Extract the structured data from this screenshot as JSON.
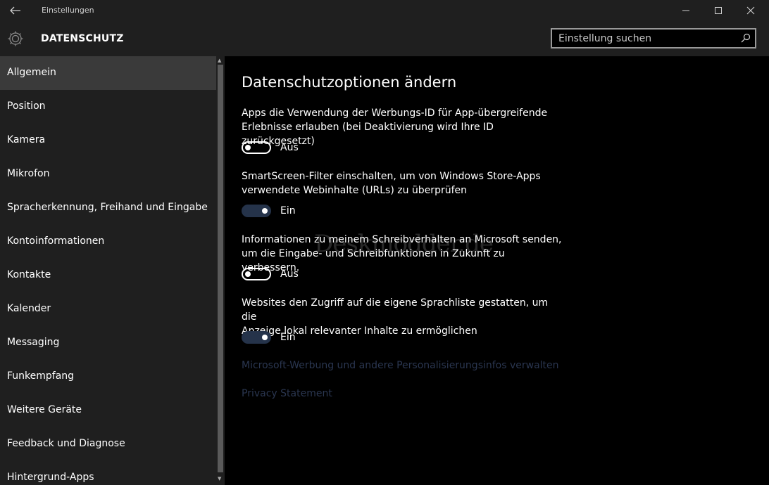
{
  "window": {
    "title": "Einstellungen"
  },
  "header": {
    "section_title": "DATENSCHUTZ",
    "search_placeholder": "Einstellung suchen"
  },
  "sidebar": {
    "items": [
      {
        "label": "Allgemein",
        "active": true
      },
      {
        "label": "Position"
      },
      {
        "label": "Kamera"
      },
      {
        "label": "Mikrofon"
      },
      {
        "label": "Spracherkennung, Freihand und Eingabe"
      },
      {
        "label": "Kontoinformationen"
      },
      {
        "label": "Kontakte"
      },
      {
        "label": "Kalender"
      },
      {
        "label": "Messaging"
      },
      {
        "label": "Funkempfang"
      },
      {
        "label": "Weitere Geräte"
      },
      {
        "label": "Feedback und Diagnose"
      },
      {
        "label": "Hintergrund-Apps"
      }
    ]
  },
  "main": {
    "title": "Datenschutzoptionen ändern",
    "options": [
      {
        "line1": "Apps die Verwendung der Werbungs-ID für App-übergreifende",
        "line2": "Erlebnisse erlauben (bei Deaktivierung wird Ihre ID zurückgesetzt)",
        "state": "Aus"
      },
      {
        "line1": "SmartScreen-Filter einschalten, um von Windows Store-Apps",
        "line2": "verwendete Webinhalte (URLs) zu überprüfen",
        "state": "Ein"
      },
      {
        "line1": "Informationen zu meinem Schreibverhalten an Microsoft senden,",
        "line2": "um die Eingabe- und Schreibfunktionen in Zukunft zu verbessern.",
        "state": "Aus"
      },
      {
        "line1": "Websites den Zugriff auf die eigene Sprachliste gestatten, um die",
        "line2": "Anzeige lokal relevanter Inhalte zu ermöglichen",
        "state": "Ein"
      }
    ],
    "links": [
      "Microsoft-Werbung und andere Personalisierungsinfos verwalten",
      "Privacy Statement"
    ],
    "watermark": "Deskmodder.de"
  },
  "colors": {
    "toggle_on": "#25334a",
    "link": "#2a3650",
    "chrome": "#1f1f1f",
    "active_item": "#3a3a3a"
  },
  "icons": {
    "back": "arrow-left-icon",
    "settings": "gear-icon",
    "search": "search-icon",
    "minimize": "minimize-icon",
    "maximize": "maximize-icon",
    "close": "close-icon"
  }
}
